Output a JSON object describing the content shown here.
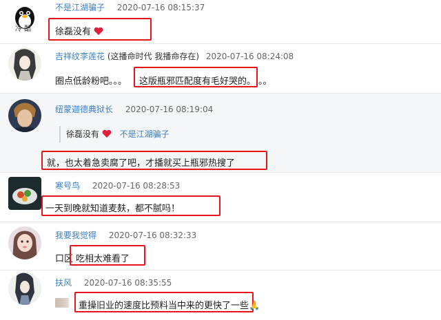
{
  "comments": [
    {
      "user": "不是江湖骗子",
      "extra": "",
      "time": "2020-07-16 08:15:37",
      "text": "徐磊没有",
      "avatar_label": "冷 酷"
    },
    {
      "user": "吉祥纹李莲花",
      "extra": "(这播命时代 我播命存在)",
      "time": "2020-07-16 08:24:08",
      "text_a": "圈点低龄粉吧。。。",
      "text_b": "这版瓶邪匹配度有毛好哭的。",
      "text_c": "。。"
    },
    {
      "user": "纽蒙迦德典狱长",
      "extra": "",
      "time": "2020-07-16 08:19:04",
      "quote_text": "徐磊没有",
      "quote_user": "不是江湖骗子",
      "text": "就，也太着急卖腐了吧，才播就买上瓶邪热搜了"
    },
    {
      "user": "寒号鸟",
      "extra": "",
      "time": "2020-07-16 08:28:53",
      "text": "一天到晚就知道麦麸，都不腻吗！"
    },
    {
      "user": "我要我觉得",
      "extra": "",
      "time": "2020-07-16 08:32:33",
      "text_a": "口区",
      "text_b": "吃相太难看了"
    },
    {
      "user": "扶风",
      "extra": "",
      "time": "2020-07-16 08:35:55",
      "text": "重操旧业的速度比预料当中来的更快了一些",
      "emoji": "🙏"
    }
  ],
  "colors": {
    "username": "#3b7fc4",
    "highlight_box": "#e8141c",
    "heart": "#e0203a"
  }
}
